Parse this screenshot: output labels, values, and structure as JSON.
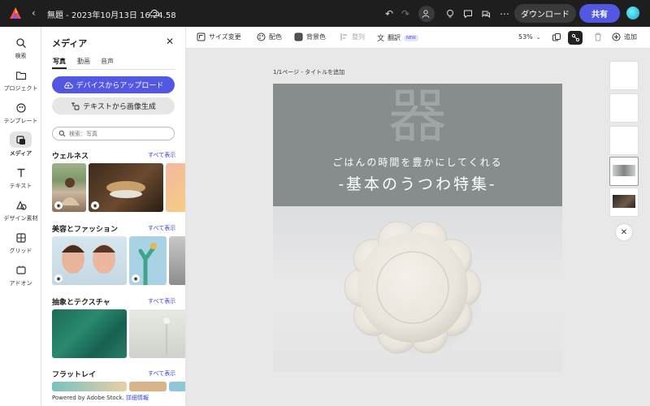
{
  "topbar": {
    "title": "無題 - 2023年10月13日 16.24.58",
    "download_label": "ダウンロード",
    "share_label": "共有"
  },
  "rail": {
    "items": [
      {
        "label": "検索",
        "icon": "search-icon"
      },
      {
        "label": "プロジェクト",
        "icon": "folder-icon"
      },
      {
        "label": "テンプレート",
        "icon": "template-icon"
      },
      {
        "label": "メディア",
        "icon": "media-icon"
      },
      {
        "label": "テキスト",
        "icon": "text-icon"
      },
      {
        "label": "デザイン素材",
        "icon": "shapes-icon"
      },
      {
        "label": "グリッド",
        "icon": "grid-icon"
      },
      {
        "label": "アドオン",
        "icon": "addon-icon"
      }
    ]
  },
  "panel": {
    "title": "メディア",
    "tabs": [
      "写真",
      "動画",
      "音声"
    ],
    "upload_label": "デバイスからアップロード",
    "generate_label": "テキストから画像生成",
    "search_placeholder": "検索：写真",
    "sections": [
      {
        "title": "ウェルネス",
        "see_all": "すべて表示"
      },
      {
        "title": "美容とファッション",
        "see_all": "すべて表示"
      },
      {
        "title": "抽象とテクスチャ",
        "see_all": "すべて表示"
      },
      {
        "title": "フラットレイ",
        "see_all": "すべて表示"
      }
    ],
    "footer_text": "Powered by Adobe Stock.",
    "footer_link": "詳細情報"
  },
  "toolbar": {
    "resize": "サイズ変更",
    "color": "配色",
    "background": "背景色",
    "arrange": "整列",
    "translate": "翻訳",
    "new_badge": "NEW",
    "zoom": "53%",
    "add": "追加"
  },
  "canvas": {
    "page_label": "1/1ページ - タイトルを追加",
    "kanji": "器",
    "subtitle": "ごはんの時間を豊かにしてくれる",
    "headline": "-基本のうつわ特集-"
  },
  "colors": {
    "accent": "#5258e4",
    "topbar": "#1e1e1e",
    "banner": "#878c8c"
  }
}
